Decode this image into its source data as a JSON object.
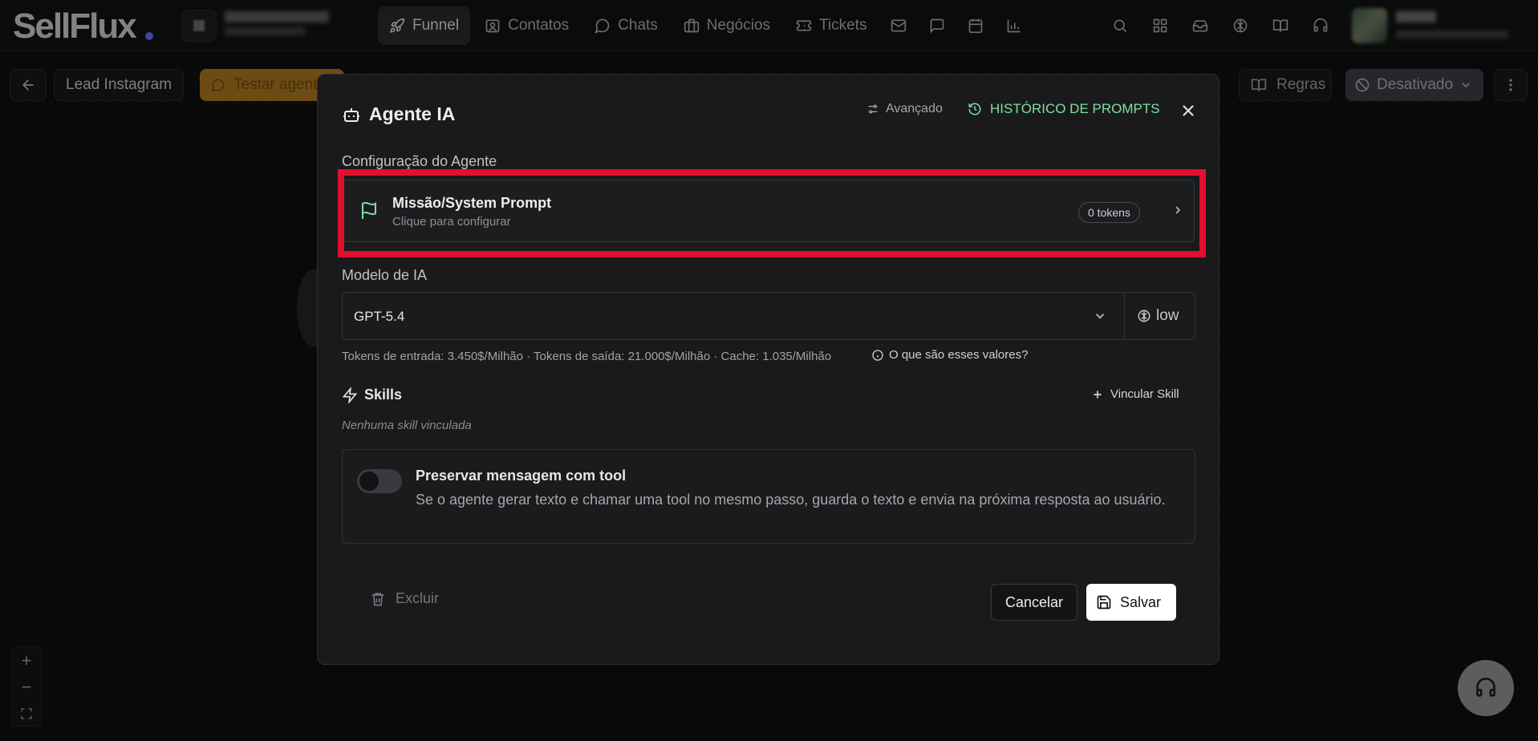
{
  "app": {
    "logo": "SellFlux"
  },
  "nav": {
    "items": [
      {
        "label": "Funnel",
        "icon": "rocket-icon",
        "active": true
      },
      {
        "label": "Contatos",
        "icon": "contacts-icon"
      },
      {
        "label": "Chats",
        "icon": "chat-bubble-icon"
      },
      {
        "label": "Negócios",
        "icon": "briefcase-icon"
      },
      {
        "label": "Tickets",
        "icon": "ticket-icon"
      }
    ],
    "icon_items": [
      "mail-icon",
      "message-square-icon",
      "calendar-icon",
      "bar-chart-icon"
    ]
  },
  "header_icons": [
    "search-icon",
    "apps-grid-icon",
    "inbox-icon",
    "brain-icon",
    "book-open-icon",
    "headset-icon"
  ],
  "toolbar": {
    "flow_name": "Lead Instagram",
    "test_agent_label": "Testar agente",
    "rules_label": "Regras",
    "status_label": "Desativado"
  },
  "zoom": {
    "in": "+",
    "out": "−",
    "fit": "⛶"
  },
  "modal": {
    "title": "Agente IA",
    "advanced_label": "Avançado",
    "history_label": "HISTÓRICO DE PROMPTS",
    "config_section": "Configuração do Agente",
    "mission": {
      "title": "Missão/System Prompt",
      "subtitle": "Clique para configurar",
      "tokens": "0 tokens"
    },
    "model_section": "Modelo de IA",
    "model": {
      "value": "GPT-5.4",
      "effort": "low"
    },
    "pricing": "Tokens de entrada: 3.450$/Milhão · Tokens de saída: 21.000$/Milhão · Cache: 1.035/Milhão",
    "pricing_help": "O que são esses valores?",
    "skills": {
      "title": "Skills",
      "link_label": "Vincular Skill",
      "empty": "Nenhuma skill vinculada"
    },
    "preserve": {
      "title": "Preservar mensagem com tool",
      "description": "Se o agente gerar texto e chamar uma tool no mesmo passo, guarda o texto e envia na próxima resposta ao usuário.",
      "enabled": false
    },
    "delete_label": "Excluir",
    "cancel_label": "Cancelar",
    "save_label": "Salvar"
  },
  "colors": {
    "accent_green": "#7ee0a3",
    "highlight_red": "#e0102f",
    "test_button": "#a8731c"
  }
}
